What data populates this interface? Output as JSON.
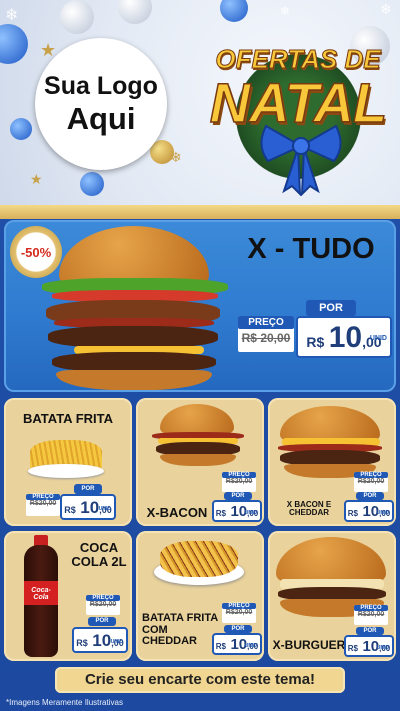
{
  "header": {
    "logo_line1": "Sua Logo",
    "logo_line2": "Aqui",
    "title_line1": "OFERTAS DE",
    "title_line2": "NATAL"
  },
  "featured": {
    "name": "X - TUDO",
    "discount_badge": "-50%",
    "price_label": "PREÇO",
    "old_price": "R$ 20,00",
    "por_label": "POR",
    "new_price_currency": "R$",
    "new_price_int": "10",
    "new_price_dec": ",00",
    "unit": "UNID"
  },
  "products": [
    {
      "name": "BATATA FRITA",
      "price_label": "PREÇO",
      "old_price": "R$20,00",
      "por_label": "POR",
      "currency": "R$",
      "int": "10",
      "dec": ",00",
      "unit": "UNID"
    },
    {
      "name": "X-BACON",
      "price_label": "PREÇO",
      "old_price": "R$20,00",
      "por_label": "POR",
      "currency": "R$",
      "int": "10",
      "dec": ",00",
      "unit": "UNID"
    },
    {
      "name": "X BACON E CHEDDAR",
      "price_label": "PREÇO",
      "old_price": "R$20,00",
      "por_label": "POR",
      "currency": "R$",
      "int": "10",
      "dec": ",00",
      "unit": "UNID"
    },
    {
      "name": "COCA COLA 2L",
      "price_label": "PREÇO",
      "old_price": "R$20,00",
      "por_label": "POR",
      "currency": "R$",
      "int": "10",
      "dec": ",00",
      "unit": "UNID"
    },
    {
      "name": "BATATA FRITA COM CHEDDAR",
      "price_label": "PREÇO",
      "old_price": "R$20,00",
      "por_label": "POR",
      "currency": "R$",
      "int": "10",
      "dec": ",00",
      "unit": "UNID"
    },
    {
      "name": "X-BURGUER",
      "price_label": "PREÇO",
      "old_price": "R$20,00",
      "por_label": "POR",
      "currency": "R$",
      "int": "10",
      "dec": ",00",
      "unit": "UNID"
    }
  ],
  "coke_label": "Coca-Cola",
  "cta": "Crie seu encarte com este tema!",
  "disclaimer": "*Imagens Meramente Ilustrativas",
  "colors": {
    "blue": "#1f58b5",
    "gold": "#f9c83a",
    "card": "#e9d29c"
  }
}
